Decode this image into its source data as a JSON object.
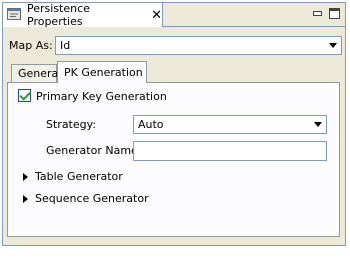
{
  "window": {
    "view_tab_title": "Persistence Properties",
    "close_glyph": "✕",
    "icons": [
      "properties-icon",
      "close-icon",
      "minimize-icon",
      "maximize-icon"
    ]
  },
  "map_as": {
    "label": "Map As:",
    "value": "Id"
  },
  "tabs": [
    {
      "label": "General",
      "active": false
    },
    {
      "label": "PK Generation",
      "active": true
    }
  ],
  "pk_generation": {
    "primary_key_label": "Primary Key Generation",
    "primary_key_checked": true,
    "strategy_label": "Strategy:",
    "strategy_value": "Auto",
    "generator_name_label": "Generator Name:",
    "generator_name_value": "",
    "table_generator_label": "Table Generator",
    "sequence_generator_label": "Sequence Generator"
  }
}
